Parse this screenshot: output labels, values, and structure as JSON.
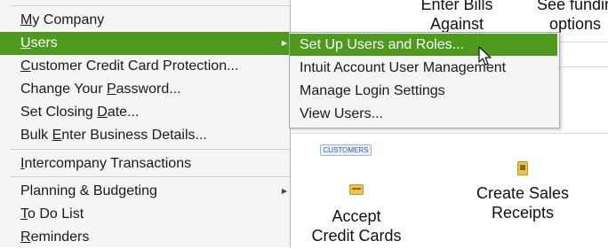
{
  "background": {
    "header_partial_y": "y",
    "enter_bills_line1": "Enter Bills",
    "enter_bills_line2": "Against",
    "funding_line1": "See fundin",
    "funding_line2": "options",
    "badge": "CUSTOMERS",
    "accept_cc_line1": "Accept",
    "accept_cc_line2": "Credit Cards",
    "create_sales_line1": "Create Sales",
    "create_sales_line2": "Receipts"
  },
  "menu": {
    "items": [
      {
        "label": "My Company",
        "mnemonic": "M"
      },
      {
        "label": "Users",
        "mnemonic": "U",
        "has_submenu": true
      },
      {
        "label": "Customer Credit Card Protection...",
        "mnemonic": "C"
      },
      {
        "label": "Change Your Password...",
        "mnemonic": "P"
      },
      {
        "label": "Set Closing Date...",
        "mnemonic": "D"
      },
      {
        "label": "Bulk Enter Business Details...",
        "mnemonic": "E"
      },
      {
        "label": "Intercompany Transactions",
        "mnemonic": "I"
      },
      {
        "label": "Planning & Budgeting",
        "has_submenu": true
      },
      {
        "label": "To Do List",
        "mnemonic": "T"
      },
      {
        "label": "Reminders",
        "mnemonic": "R"
      }
    ],
    "submenu_arrow": "▶"
  },
  "submenu": {
    "items": [
      {
        "label": "Set Up Users and Roles..."
      },
      {
        "label": "Intuit Account User Management"
      },
      {
        "label": "Manage Login Settings"
      },
      {
        "label": "View Users..."
      }
    ]
  },
  "colors": {
    "highlight": "#4e9a1f",
    "menu_bg": "#f5f5f5"
  }
}
